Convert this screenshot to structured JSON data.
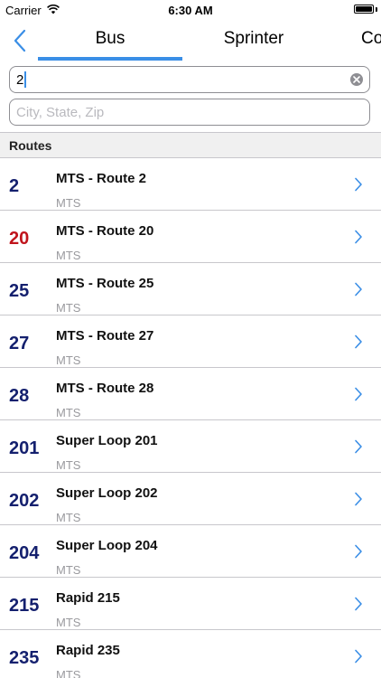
{
  "status_bar": {
    "carrier": "Carrier",
    "time": "6:30 AM",
    "wifi_icon": "wifi-icon",
    "battery_level": 1.0
  },
  "nav": {
    "back_icon": "chevron-left-icon",
    "tabs": [
      {
        "label": "Bus",
        "selected": true
      },
      {
        "label": "Sprinter",
        "selected": false
      },
      {
        "label": "Co",
        "selected": false
      }
    ],
    "accent_color": "#3a8ee6"
  },
  "search": {
    "route_value": "2",
    "city_placeholder": "City, State, Zip"
  },
  "section": {
    "title": "Routes"
  },
  "routes": [
    {
      "number": "2",
      "title": "MTS - Route 2",
      "agency": "MTS",
      "color": "#14206e"
    },
    {
      "number": "20",
      "title": "MTS - Route 20",
      "agency": "MTS",
      "color": "#c0141c"
    },
    {
      "number": "25",
      "title": "MTS - Route 25",
      "agency": "MTS",
      "color": "#14206e"
    },
    {
      "number": "27",
      "title": "MTS - Route 27",
      "agency": "MTS",
      "color": "#14206e"
    },
    {
      "number": "28",
      "title": "MTS - Route 28",
      "agency": "MTS",
      "color": "#14206e"
    },
    {
      "number": "201",
      "title": "Super Loop 201",
      "agency": "MTS",
      "color": "#14206e"
    },
    {
      "number": "202",
      "title": "Super Loop 202",
      "agency": "MTS",
      "color": "#14206e"
    },
    {
      "number": "204",
      "title": "Super Loop 204",
      "agency": "MTS",
      "color": "#14206e"
    },
    {
      "number": "215",
      "title": "Rapid 215",
      "agency": "MTS",
      "color": "#14206e"
    },
    {
      "number": "235",
      "title": "Rapid 235",
      "agency": "MTS",
      "color": "#14206e"
    }
  ]
}
